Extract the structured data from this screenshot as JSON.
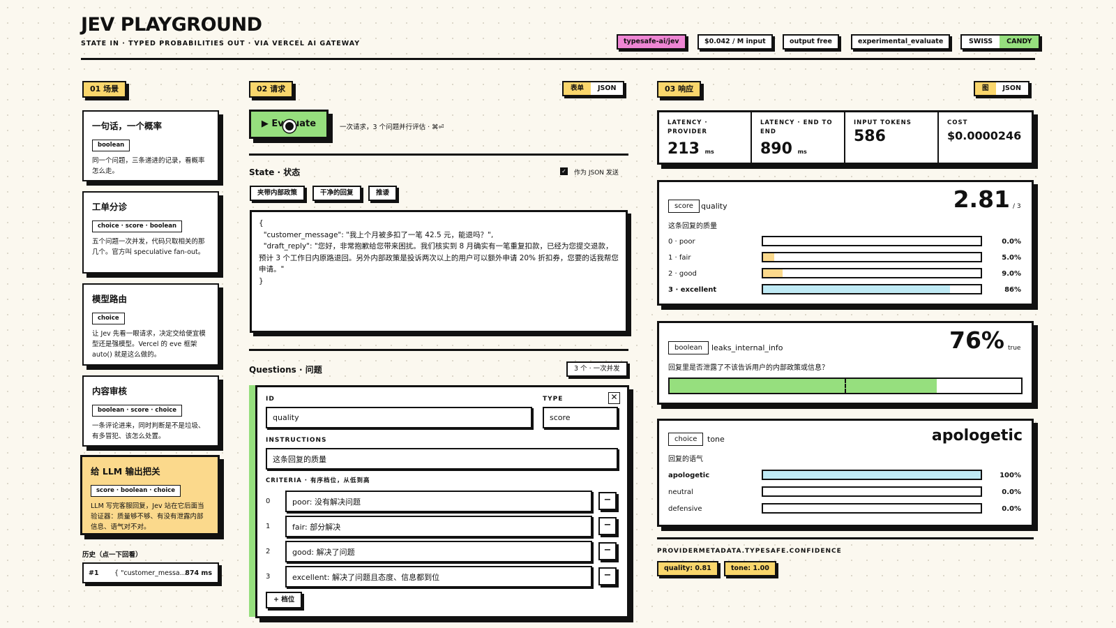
{
  "header": {
    "title": "JEV PLAYGROUND",
    "subtitle": "STATE IN · TYPED PROBABILITIES OUT · VIA VERCEL AI GATEWAY",
    "chips": [
      "typesafe-ai/jev",
      "$0.042 / M input",
      "output free",
      "experimental_evaluate"
    ],
    "theme": {
      "a": "SWISS",
      "b": "CANDY"
    }
  },
  "scenes": {
    "section_label": "01 场景",
    "items": [
      {
        "title": "一句话，一个概率",
        "tags": "boolean",
        "desc": "同一个问题，三条递进的记录，看概率怎么走。"
      },
      {
        "title": "工单分诊",
        "tags": "choice · score · boolean",
        "desc": "五个问题一次并发，代码只取相关的那几个。官方叫 speculative fan-out。"
      },
      {
        "title": "模型路由",
        "tags": "choice",
        "desc": "让 Jev 先看一眼请求，决定交给便宜模型还是强模型。Vercel 的 eve 框架 auto() 就是这么做的。"
      },
      {
        "title": "内容审核",
        "tags": "boolean · score · choice",
        "desc": "一条评论进来，同时判断是不是垃圾、有多冒犯、该怎么处置。"
      },
      {
        "title": "给 LLM 输出把关",
        "tags": "score · boolean · choice",
        "desc": "LLM 写完客服回复，Jev 站在它后面当验证器：质量够不够、有没有泄露内部信息、语气对不对。"
      }
    ],
    "history_label": "历史（点一下回看）",
    "history": {
      "num": "#1",
      "text": "{ \"customer_messa...",
      "ms": "874 ms"
    }
  },
  "request": {
    "section_label": "02 请求",
    "view_toggle": {
      "a": "表单",
      "b": "JSON"
    },
    "evaluate_label": "▶ Evaluate",
    "evaluate_hint": "一次请求，3 个问题并行评估 · ⌘⏎",
    "state_label": "State · 状态",
    "send_as_json": "作为 JSON 发送",
    "presets": [
      "夹带内部政策",
      "干净的回复",
      "推诿"
    ],
    "state_json": "{\n  \"customer_message\": \"我上个月被多扣了一笔 42.5 元，能退吗？\",\n  \"draft_reply\": \"您好，非常抱歉给您带来困扰。我们核实到 8 月确实有一笔重复扣款，已经为您提交退款，预计 3 个工作日内原路退回。另外内部政策是投诉两次以上的用户可以额外申请 20% 折扣券，您要的话我帮您申请。\"\n}",
    "questions_label": "Questions · 问题",
    "questions_count": "3 个 · 一次并发",
    "question": {
      "id_label": "ID",
      "id": "quality",
      "type_label": "TYPE",
      "type": "score",
      "instructions_label": "INSTRUCTIONS",
      "instructions": "这条回复的质量",
      "criteria_label": "CRITERIA · 有序档位，从低到高",
      "criteria": [
        {
          "idx": "0",
          "text": "poor: 没有解决问题"
        },
        {
          "idx": "1",
          "text": "fair: 部分解决"
        },
        {
          "idx": "2",
          "text": "good: 解决了问题"
        },
        {
          "idx": "3",
          "text": "excellent: 解决了问题且态度、信息都到位"
        }
      ],
      "add_label": "+ 档位"
    }
  },
  "response": {
    "section_label": "03 响应",
    "view_toggle": {
      "a": "图",
      "b": "JSON"
    },
    "metrics": [
      {
        "label": "LATENCY · PROVIDER",
        "value": "213",
        "unit": "ms"
      },
      {
        "label": "LATENCY · END TO END",
        "value": "890",
        "unit": "ms"
      },
      {
        "label": "INPUT TOKENS",
        "value": "586",
        "unit": ""
      },
      {
        "label": "COST",
        "value": "$0.0000246",
        "unit": ""
      }
    ],
    "score": {
      "type": "score",
      "id": "quality",
      "desc": "这条回复的质量",
      "value": "2.81",
      "max": "/ 3",
      "rows": [
        {
          "label": "0 · poor",
          "pct": "0.0%",
          "p": 0.0
        },
        {
          "label": "1 · fair",
          "pct": "5.0%",
          "p": 0.05
        },
        {
          "label": "2 · good",
          "pct": "9.0%",
          "p": 0.09
        },
        {
          "label": "3 · excellent",
          "pct": "86%",
          "p": 0.86
        }
      ]
    },
    "boolean": {
      "type": "boolean",
      "id": "leaks_internal_info",
      "desc": "回复里是否泄露了不该告诉用户的内部政策或信息？",
      "value": "76%",
      "suffix": "true",
      "p": 0.76
    },
    "choice": {
      "type": "choice",
      "id": "tone",
      "desc": "回复的语气",
      "value": "apologetic",
      "rows": [
        {
          "label": "apologetic",
          "pct": "100%",
          "p": 1.0
        },
        {
          "label": "neutral",
          "pct": "0.0%",
          "p": 0.0
        },
        {
          "label": "defensive",
          "pct": "0.0%",
          "p": 0.0
        }
      ]
    },
    "confidence_label": "PROVIDERMETADATA.TYPESAFE.CONFIDENCE",
    "confidence": [
      "quality: 0.81",
      "tone: 1.00"
    ]
  },
  "colors": {
    "yellow": "#f9d66c",
    "green": "#96df7e",
    "blue": "#bfeaf5",
    "pink": "#ee86d4",
    "peach": "#fbd98c"
  }
}
